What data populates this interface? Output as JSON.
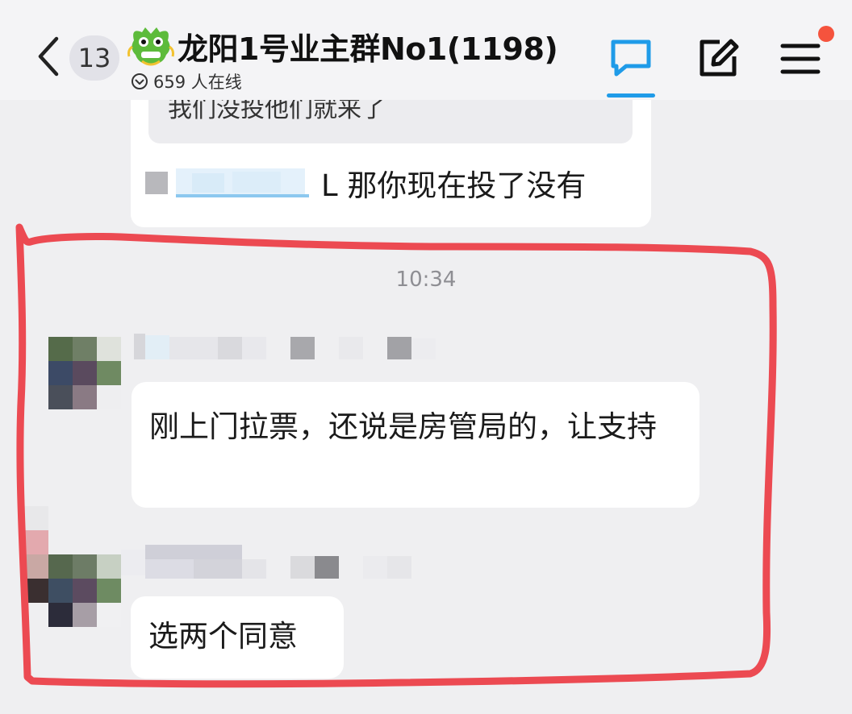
{
  "header": {
    "back_icon": "chevron-left-icon",
    "unread_count": "13",
    "group_avatar_icon": "dragon-emoji-icon",
    "group_name": "龙阳1号业主群No1(1198)",
    "online_icon": "online-status-icon",
    "online_text": "659 人在线",
    "actions": [
      {
        "icon": "chat-bubble-icon",
        "active": true
      },
      {
        "icon": "edit-icon"
      },
      {
        "icon": "menu-icon",
        "has_notification_dot": true
      }
    ]
  },
  "messages": [
    {
      "quote_text": "我们没投他们就来了",
      "mention_suffix": "L",
      "text": "那你现在投了没有"
    },
    {
      "timestamp": "10:34"
    },
    {
      "sender_avatar": "pixelated-avatar",
      "text": "刚上门拉票，还说是房管局的，让支持"
    },
    {
      "sender_avatar": "pixelated-avatar",
      "text": "选两个同意"
    }
  ],
  "colors": {
    "background": "#efeff1",
    "bubble": "#ffffff",
    "accent": "#1f9be8",
    "notification_dot": "#f5533d",
    "annotation": "#ec4a52"
  }
}
